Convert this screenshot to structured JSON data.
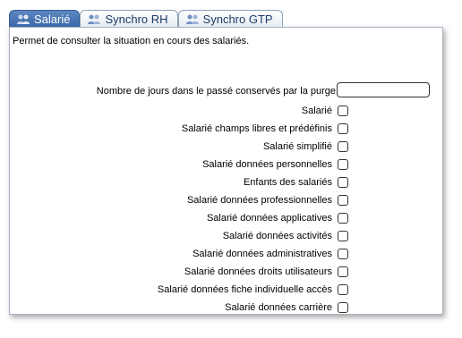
{
  "tabs": [
    {
      "label": "Salarié",
      "active": true,
      "icon": "users-icon"
    },
    {
      "label": "Synchro RH",
      "active": false,
      "icon": "users-icon"
    },
    {
      "label": "Synchro GTP",
      "active": false,
      "icon": "users-icon"
    }
  ],
  "description": "Permet de consulter la situation en cours des salariés.",
  "purge": {
    "label": "Nombre de jours dans le passé conservés par la purge",
    "value": "",
    "placeholder": ""
  },
  "checkboxes": [
    {
      "label": "Salarié",
      "checked": false
    },
    {
      "label": "Salarié champs libres et prédéfinis",
      "checked": false
    },
    {
      "label": "Salarié simplifié",
      "checked": false
    },
    {
      "label": "Salarié données personnelles",
      "checked": false
    },
    {
      "label": "Enfants des salariés",
      "checked": false
    },
    {
      "label": "Salarié données professionnelles",
      "checked": false
    },
    {
      "label": "Salarié données applicatives",
      "checked": false
    },
    {
      "label": "Salarié données activités",
      "checked": false
    },
    {
      "label": "Salarié données administratives",
      "checked": false
    },
    {
      "label": "Salarié données droits utilisateurs",
      "checked": false
    },
    {
      "label": "Salarié données fiche individuelle accès",
      "checked": false
    },
    {
      "label": "Salarié données carrière",
      "checked": false
    }
  ],
  "colors": {
    "tab_active": "#4a76b4",
    "tab_text": "#1c3a66",
    "border": "#a8b4c4"
  }
}
